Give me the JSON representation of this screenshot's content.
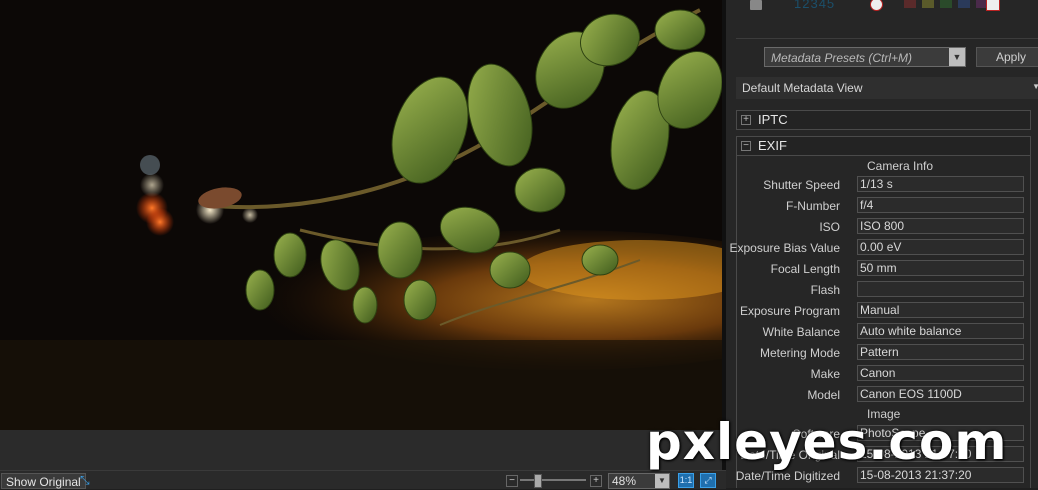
{
  "viewer": {
    "show_original": "Show Original",
    "zoom": "48%"
  },
  "panel": {
    "presets_placeholder": "Metadata Presets (Ctrl+M)",
    "apply": "Apply",
    "view": "Default Metadata View",
    "sections": {
      "iptc": "IPTC",
      "exif": "EXIF"
    },
    "camera_info": {
      "title": "Camera Info",
      "rows": [
        {
          "label": "Shutter Speed",
          "value": "1/13 s"
        },
        {
          "label": "F-Number",
          "value": "f/4"
        },
        {
          "label": "ISO",
          "value": "ISO 800"
        },
        {
          "label": "Exposure Bias Value",
          "value": "0.00 eV"
        },
        {
          "label": "Focal Length",
          "value": "50 mm"
        },
        {
          "label": "Flash",
          "value": ""
        },
        {
          "label": "Exposure Program",
          "value": "Manual"
        },
        {
          "label": "White Balance",
          "value": "Auto white balance"
        },
        {
          "label": "Metering Mode",
          "value": "Pattern"
        },
        {
          "label": "Make",
          "value": "Canon"
        },
        {
          "label": "Model",
          "value": "Canon EOS 1100D"
        }
      ]
    },
    "image_group": {
      "title": "Image",
      "rows": [
        {
          "label": "Software",
          "value": "PhotoScape"
        },
        {
          "label": "Date/Time Original",
          "value": "15-08-2013 21:37:20"
        },
        {
          "label": "Date/Time Digitized",
          "value": "15-08-2013 21:37:20"
        }
      ]
    }
  },
  "watermark": "pxleyes.com",
  "colors": {
    "accent_blue": "#1f6fae",
    "panel_bg": "#262626",
    "leaf_green": "#6f8a3a",
    "street_orange": "#c87a1a"
  }
}
